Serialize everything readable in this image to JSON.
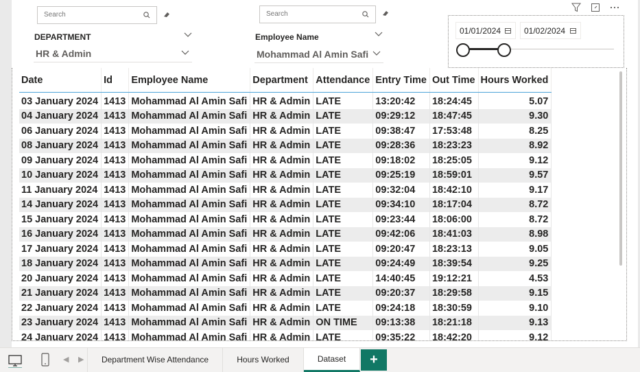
{
  "slicers": {
    "department": {
      "search_placeholder": "Search",
      "title": "DEPARTMENT",
      "selected": "HR & Admin"
    },
    "employee": {
      "search_placeholder": "Search",
      "title": "Employee Name",
      "selected": "Mohammad Al Amin Safi"
    },
    "date_range": {
      "start": "01/01/2024",
      "end": "01/02/2024",
      "slider_start_fraction": 0.0,
      "slider_end_fraction": 0.27
    }
  },
  "table": {
    "columns": [
      "Date",
      "Id",
      "Employee Name",
      "Department",
      "Attendance",
      "Entry Time",
      "Out Time",
      "Hours Worked"
    ],
    "rows": [
      [
        "03 January 2024",
        "1413",
        "Mohammad Al Amin Safi",
        "HR & Admin",
        "LATE",
        "13:20:42",
        "18:24:45",
        "5.07"
      ],
      [
        "04 January 2024",
        "1413",
        "Mohammad Al Amin Safi",
        "HR & Admin",
        "LATE",
        "09:29:12",
        "18:47:45",
        "9.30"
      ],
      [
        "06 January 2024",
        "1413",
        "Mohammad Al Amin Safi",
        "HR & Admin",
        "LATE",
        "09:38:47",
        "17:53:48",
        "8.25"
      ],
      [
        "08 January 2024",
        "1413",
        "Mohammad Al Amin Safi",
        "HR & Admin",
        "LATE",
        "09:28:36",
        "18:23:23",
        "8.92"
      ],
      [
        "09 January 2024",
        "1413",
        "Mohammad Al Amin Safi",
        "HR & Admin",
        "LATE",
        "09:18:02",
        "18:25:05",
        "9.12"
      ],
      [
        "10 January 2024",
        "1413",
        "Mohammad Al Amin Safi",
        "HR & Admin",
        "LATE",
        "09:25:19",
        "18:59:01",
        "9.57"
      ],
      [
        "11 January 2024",
        "1413",
        "Mohammad Al Amin Safi",
        "HR & Admin",
        "LATE",
        "09:32:04",
        "18:42:10",
        "9.17"
      ],
      [
        "14 January 2024",
        "1413",
        "Mohammad Al Amin Safi",
        "HR & Admin",
        "LATE",
        "09:34:10",
        "18:17:04",
        "8.72"
      ],
      [
        "15 January 2024",
        "1413",
        "Mohammad Al Amin Safi",
        "HR & Admin",
        "LATE",
        "09:23:44",
        "18:06:00",
        "8.72"
      ],
      [
        "16 January 2024",
        "1413",
        "Mohammad Al Amin Safi",
        "HR & Admin",
        "LATE",
        "09:42:06",
        "18:41:03",
        "8.98"
      ],
      [
        "17 January 2024",
        "1413",
        "Mohammad Al Amin Safi",
        "HR & Admin",
        "LATE",
        "09:20:47",
        "18:23:13",
        "9.05"
      ],
      [
        "18 January 2024",
        "1413",
        "Mohammad Al Amin Safi",
        "HR & Admin",
        "LATE",
        "09:24:49",
        "18:39:54",
        "9.25"
      ],
      [
        "20 January 2024",
        "1413",
        "Mohammad Al Amin Safi",
        "HR & Admin",
        "LATE",
        "14:40:45",
        "19:12:21",
        "4.53"
      ],
      [
        "21 January 2024",
        "1413",
        "Mohammad Al Amin Safi",
        "HR & Admin",
        "LATE",
        "09:20:37",
        "18:29:58",
        "9.15"
      ],
      [
        "22 January 2024",
        "1413",
        "Mohammad Al Amin Safi",
        "HR & Admin",
        "LATE",
        "09:24:18",
        "18:30:59",
        "9.10"
      ],
      [
        "23 January 2024",
        "1413",
        "Mohammad Al Amin Safi",
        "HR & Admin",
        "ON TIME",
        "09:13:38",
        "18:21:18",
        "9.13"
      ],
      [
        "24 January 2024",
        "1413",
        "Mohammad Al Amin Safi",
        "HR & Admin",
        "LATE",
        "09:35:22",
        "18:42:20",
        "9.12"
      ]
    ]
  },
  "page_tabs": [
    {
      "label": "Department Wise Attendance",
      "active": false
    },
    {
      "label": "Hours Worked",
      "active": false
    },
    {
      "label": "Dataset",
      "active": true
    }
  ],
  "add_page_label": "+",
  "colors": {
    "accent": "#117865",
    "header_rule": "#4da3d8",
    "row_band": "#ececec"
  }
}
